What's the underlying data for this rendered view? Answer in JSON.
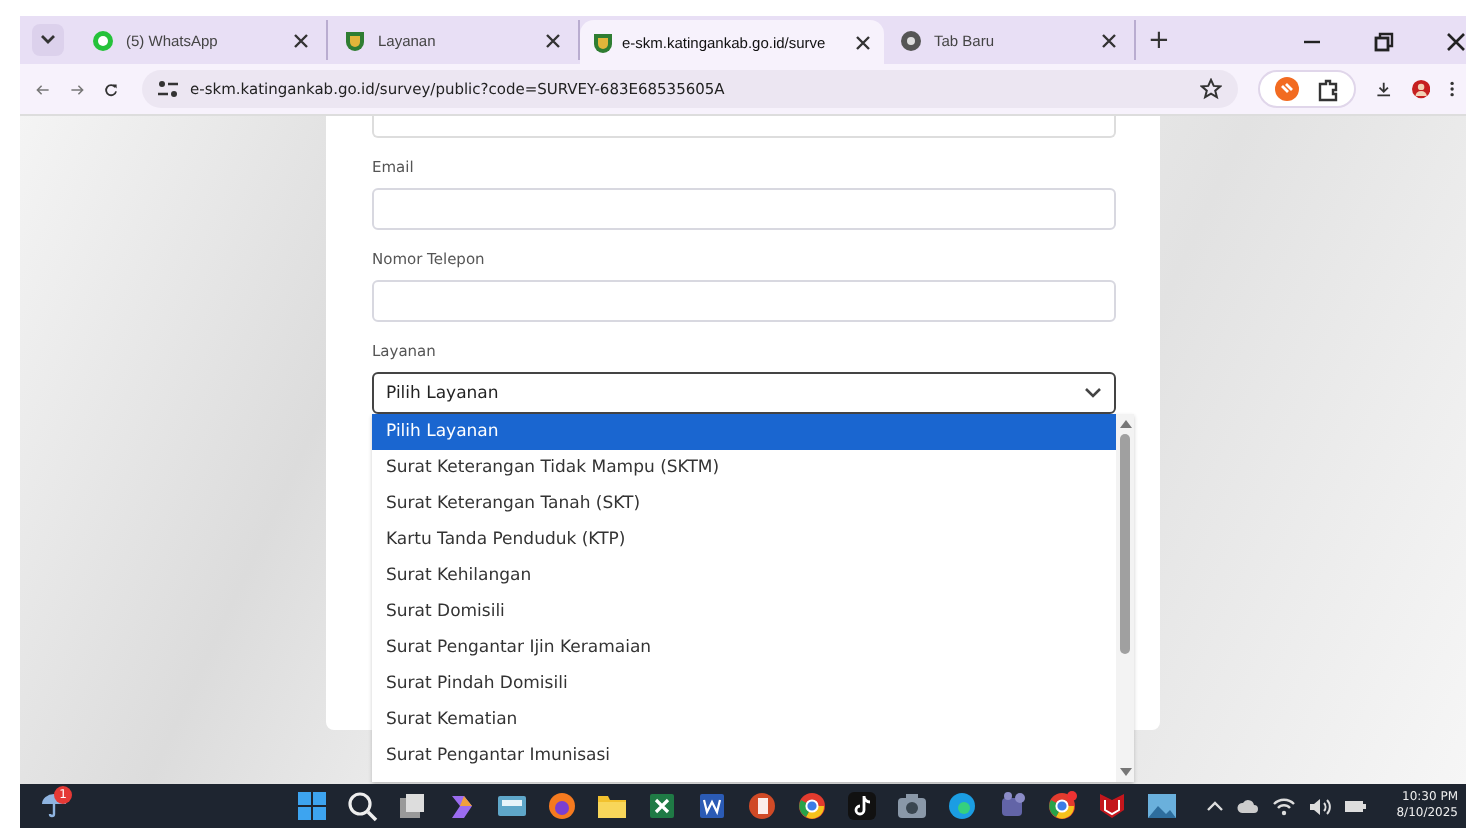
{
  "browser": {
    "tabs": [
      {
        "title": "(5) WhatsApp",
        "kind": "chat",
        "selected": false
      },
      {
        "title": "Layanan",
        "kind": "site",
        "selected": false
      },
      {
        "title": "e-skm.katingankab.go.id/surve",
        "kind": "site",
        "selected": true
      },
      {
        "title": "Tab Baru",
        "kind": "newtab",
        "selected": false
      }
    ],
    "new_tab": "+",
    "address": "e-skm.katingankab.go.id/survey/public?code=SURVEY-683E68535605A"
  },
  "form": {
    "fields": [
      {
        "label": "Email"
      },
      {
        "label": "Nomor Telepon"
      }
    ],
    "select": {
      "label": "Layanan",
      "value": "Pilih Layanan",
      "expanded": true,
      "options": [
        {
          "text": "Pilih Layanan",
          "selected": true
        },
        {
          "text": "Surat Keterangan Tidak Mampu (SKTM)",
          "selected": false
        },
        {
          "text": "Surat Keterangan Tanah (SKT)",
          "selected": false
        },
        {
          "text": "Kartu Tanda Penduduk (KTP)",
          "selected": false
        },
        {
          "text": "Surat Kehilangan",
          "selected": false
        },
        {
          "text": "Surat Domisili",
          "selected": false
        },
        {
          "text": "Surat Pengantar Ijin Keramaian",
          "selected": false
        },
        {
          "text": "Surat Pindah Domisili",
          "selected": false
        },
        {
          "text": "Surat Kematian",
          "selected": false
        },
        {
          "text": "Surat Pengantar Imunisasi",
          "selected": false
        }
      ]
    }
  },
  "taskbar": {
    "weather_badge": "1",
    "time": "10:30 PM",
    "date": "8/10/2025"
  }
}
